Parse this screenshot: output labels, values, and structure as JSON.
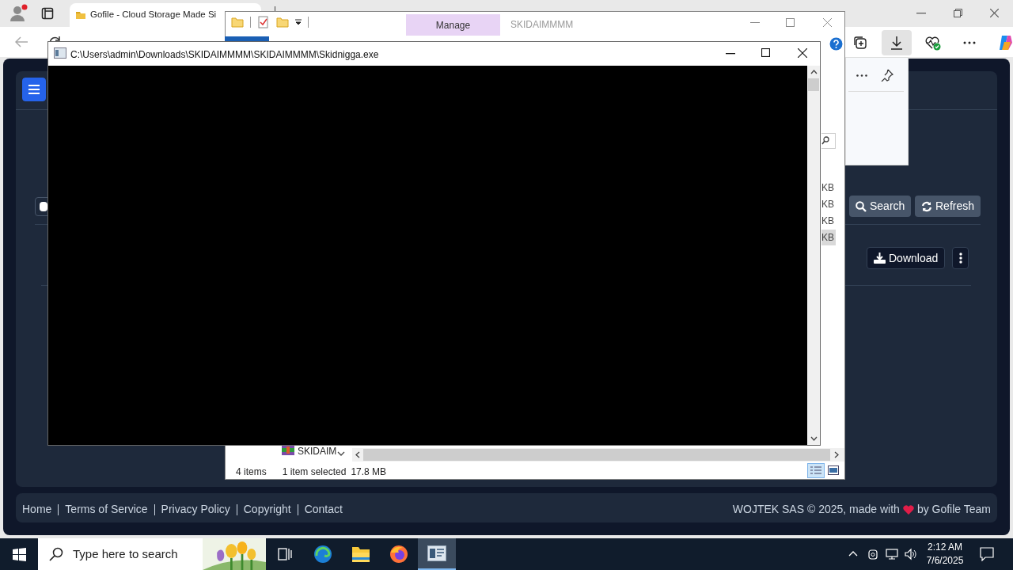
{
  "browser": {
    "tab_title": "Gofile - Cloud Storage Made Si",
    "toolbar_icons": [
      {
        "kind": "collections",
        "selected": false
      },
      {
        "kind": "downloads",
        "selected": true
      },
      {
        "kind": "health",
        "selected": false
      },
      {
        "kind": "more",
        "selected": false
      },
      {
        "kind": "copilot",
        "selected": false
      }
    ]
  },
  "page": {
    "select_all": {
      "checked": false
    },
    "search_button": "Search",
    "refresh_button": "Refresh",
    "download_button": "Download",
    "footer_links": [
      "Home",
      "Terms of Service",
      "Privacy Policy",
      "Copyright",
      "Contact"
    ],
    "footer_credit_before": "WOJTEK SAS © 2025, made with",
    "footer_credit_after": "by Gofile Team"
  },
  "explorer": {
    "title": "SKIDAIMMMM",
    "ribbon_tab": "Manage",
    "size_cells": [
      {
        "text": "KB",
        "selected": false
      },
      {
        "text": "KB",
        "selected": false
      },
      {
        "text": "KB",
        "selected": false
      },
      {
        "text": "KB",
        "selected": true
      }
    ],
    "visible_file": "SKIDAIM",
    "status": {
      "items": "4 items",
      "selection": "1 item selected",
      "size": "17.8 MB"
    }
  },
  "console": {
    "title": "C:\\Users\\admin\\Downloads\\SKIDAIMMMM\\SKIDAIMMMM\\Skidnigga.exe"
  },
  "taskbar": {
    "search_placeholder": "Type here to search",
    "time": "2:12 AM",
    "date": "7/6/2025",
    "apps": [
      {
        "kind": "task-view",
        "selected": false
      },
      {
        "kind": "edge",
        "selected": false
      },
      {
        "kind": "explorer",
        "selected": false
      },
      {
        "kind": "firefox",
        "selected": false
      },
      {
        "kind": "console",
        "selected": true
      }
    ]
  }
}
